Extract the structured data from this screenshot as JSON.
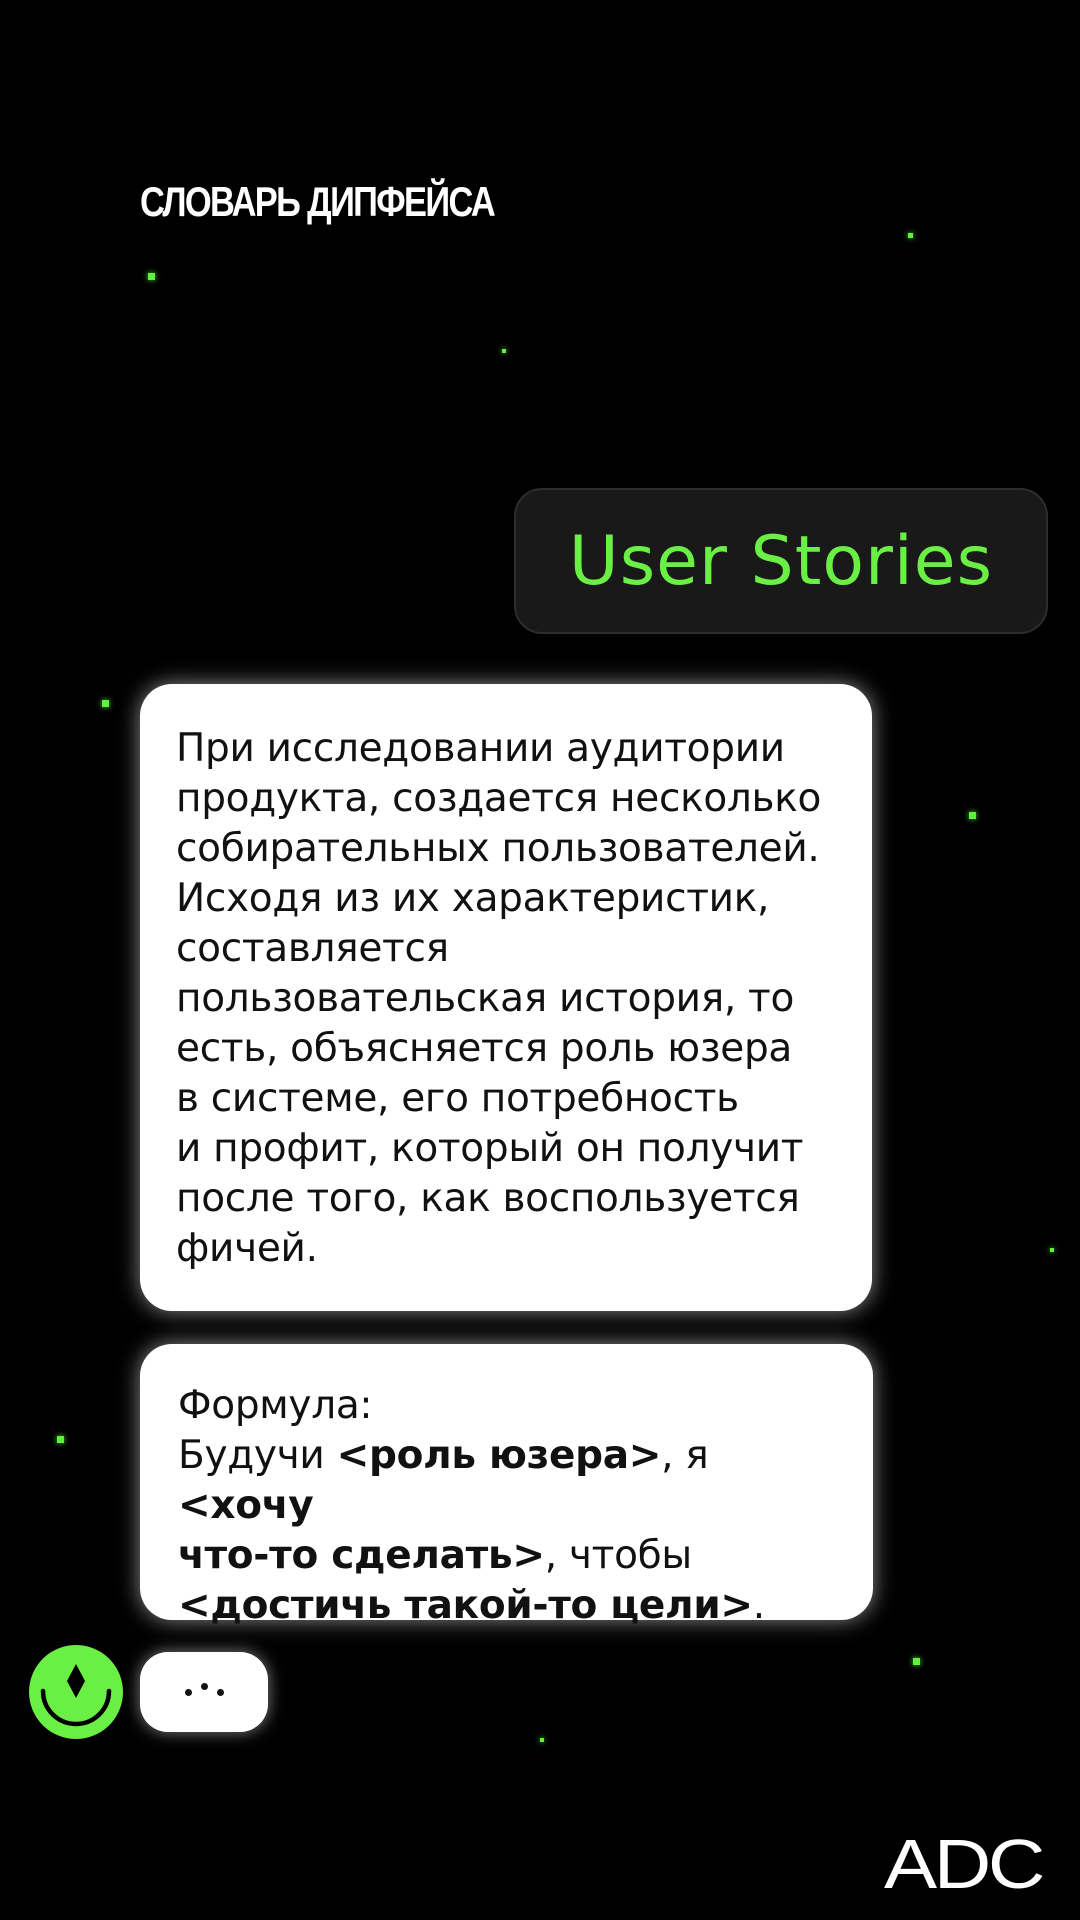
{
  "header": {
    "title": "СЛОВАРЬ ДИПФЕЙСА"
  },
  "topic": {
    "label": "User Stories"
  },
  "messages": {
    "definition": {
      "text": "При исследовании аудитории\nпродукта, создается несколько\nсобирательных пользователей.\nИсходя из их характеристик,\nсоставляется\nпользовательская история, то\nесть, объясняется роль юзера\nв системе, его потребность\nи профит, который он получит\nпосле того, как воспользуется\nфичей."
    },
    "formula": {
      "heading": "Формула:",
      "prefix": "Будучи ",
      "role": "<роль юзера>",
      "middle": ", я ",
      "want_part1": "<хочу",
      "want_part2": "что-то сделать>",
      "so_that": ", чтобы",
      "goal": "<достичь такой-то цели>",
      "end": "."
    },
    "typing": {
      "icon": "typing-dots-icon"
    }
  },
  "avatar": {
    "icon": "smiley-diamond-icon",
    "color": "#6aef45"
  },
  "brand": {
    "logo_text": "ADC"
  },
  "colors": {
    "background": "#000000",
    "accent": "#6aef45",
    "bubble": "#ffffff",
    "topic_bubble": "#191919"
  }
}
